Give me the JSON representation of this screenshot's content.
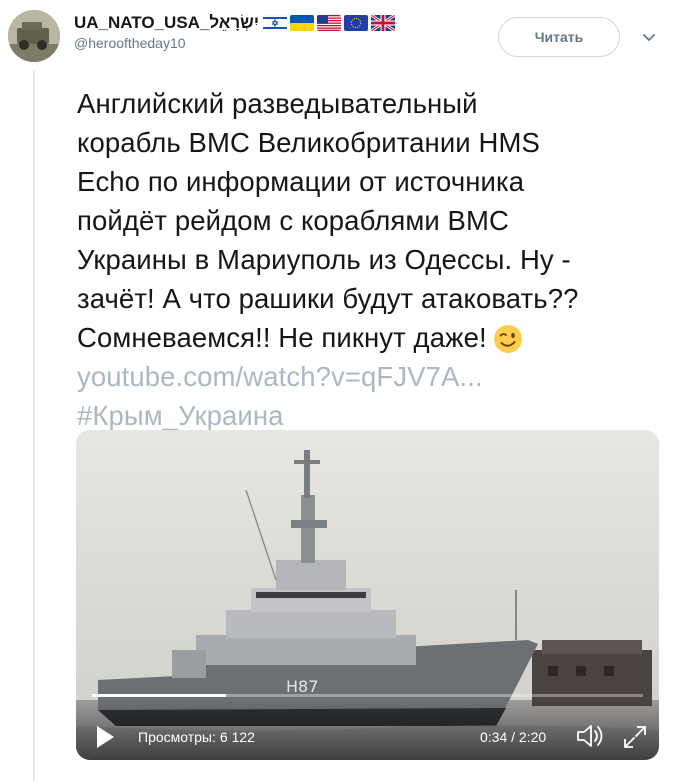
{
  "author": {
    "display_name": "UA_NATO_USA_יִשְׂרָאֵל",
    "handle": "@herooftheday10",
    "flags": [
      "israel-flag-icon",
      "ukraine-flag-icon",
      "usa-flag-icon",
      "eu-flag-icon",
      "uk-flag-icon"
    ]
  },
  "follow_button": {
    "label": "Читать"
  },
  "tweet": {
    "lines": [
      "Английский разведывательный",
      "корабль ВМС Великобритании HMS",
      "Echo по информации от источника",
      "пойдёт рейдом с кораблями ВМС",
      "Украины в Мариуполь из Одессы. Ну -",
      "зачёт! А что рашики будут атаковать??",
      "Сомневаемся!! Не пикнут даже!"
    ],
    "emoji": "winking-face-emoji",
    "link": "youtube.com/watch?v=qFJV7A...",
    "hashtag": "#Крым_Украина"
  },
  "video": {
    "hull_number": "H87",
    "views_label": "Просмотры:",
    "views_count": "6 122",
    "current_time": "0:34",
    "separator": "/",
    "duration": "2:20",
    "progress_fraction": 0.243
  },
  "colors": {
    "text": "#14171a",
    "secondary": "#657786",
    "link_faded": "#aab8c2",
    "border": "#ccd6dd"
  }
}
